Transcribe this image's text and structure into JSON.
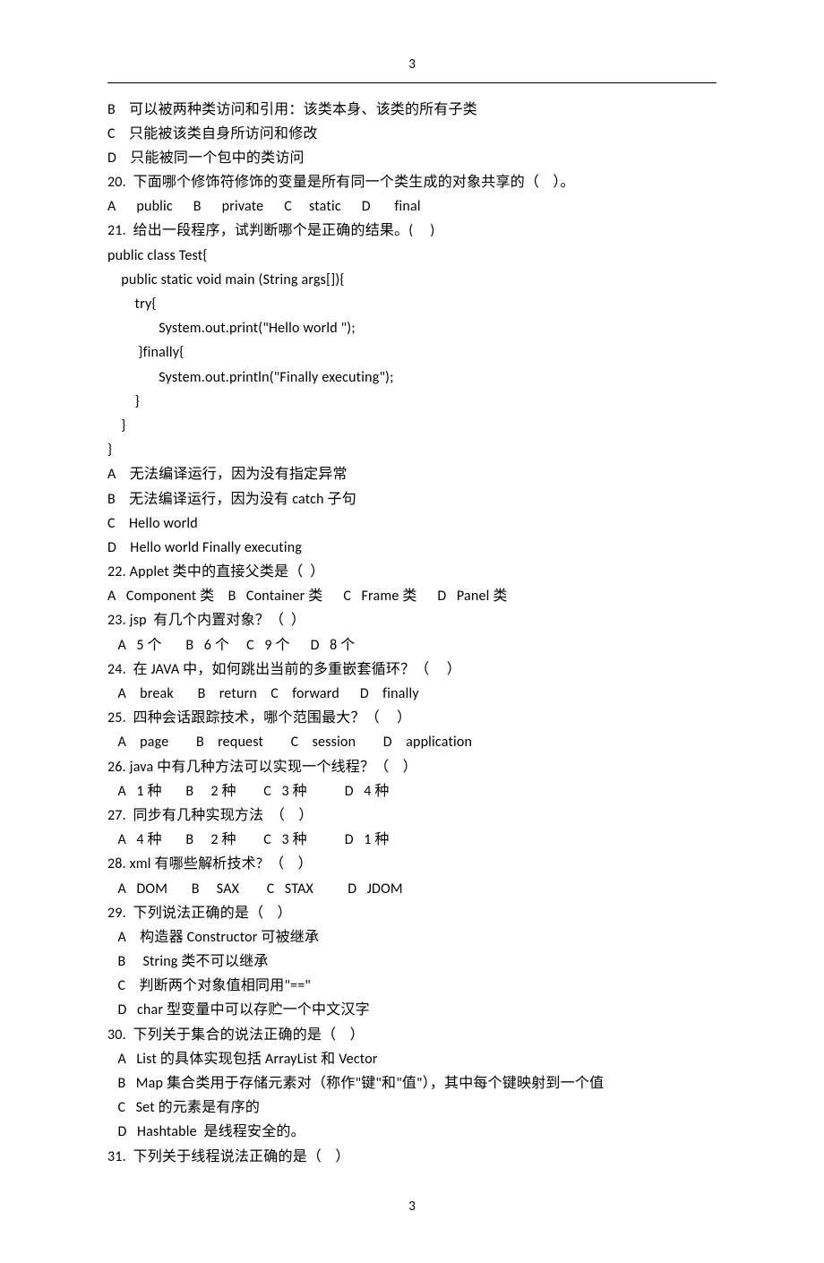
{
  "page": {
    "top_number": "3",
    "bottom_number": "3"
  },
  "body": {
    "text": "B    可以被两种类访问和引用：该类本身、该类的所有子类\nC    只能被该类自身所访问和修改\nD    只能被同一个包中的类访问\n20.  下面哪个修饰符修饰的变量是所有同一个类生成的对象共享的（    ）。\nA      public      B      private      C     static      D       final\n21.  给出一段程序，试判断哪个是正确的结果。(     )\npublic class Test{\n    public static void main (String args[]){\n        try{\n               System.out.print(\"Hello world \");\n         }finally{\n               System.out.println(\"Finally executing\");\n        }\n    }\n}\nA    无法编译运行，因为没有指定异常\nB    无法编译运行，因为没有 catch 子句\nC    Hello world\nD    Hello world Finally executing\n22. Applet 类中的直接父类是（  ）\nA   Component 类    B   Container 类      C   Frame 类      D   Panel 类\n23. jsp  有几个内置对象？（  ）\n   A   5 个       B   6 个     C   9 个      D   8 个\n24.  在 JAVA 中，如何跳出当前的多重嵌套循环？（     ）\n   A    break       B    return    C    forward      D    finally\n25.  四种会话跟踪技术，哪个范围最大？（     ）\n   A    page        B    request        C    session        D    application\n26. java 中有几种方法可以实现一个线程？（    ）\n   A   1 种       B     2 种        C   3 种           D   4 种\n27.  同步有几种实现方法  （    ）\n   A   4 种       B     2 种        C   3 种           D   1 种\n28. xml 有哪些解析技术?  （    ）\n   A   DOM       B     SAX        C   STAX          D   JDOM\n29.  下列说法正确的是（    ）\n   A    构造器 Constructor 可被继承\n   B     String 类不可以继承\n   C    判断两个对象值相同用\"==\"\n   D   char 型变量中可以存贮一个中文汉字\n30.  下列关于集合的说法正确的是（    ）\n   A   List 的具体实现包括 ArrayList 和 Vector\n   B   Map 集合类用于存储元素对（称作\"键\"和\"值\"），其中每个键映射到一个值\n   C   Set 的元素是有序的\n   D   Hashtable  是线程安全的。\n31.  下列关于线程说法正确的是（    ）"
  }
}
